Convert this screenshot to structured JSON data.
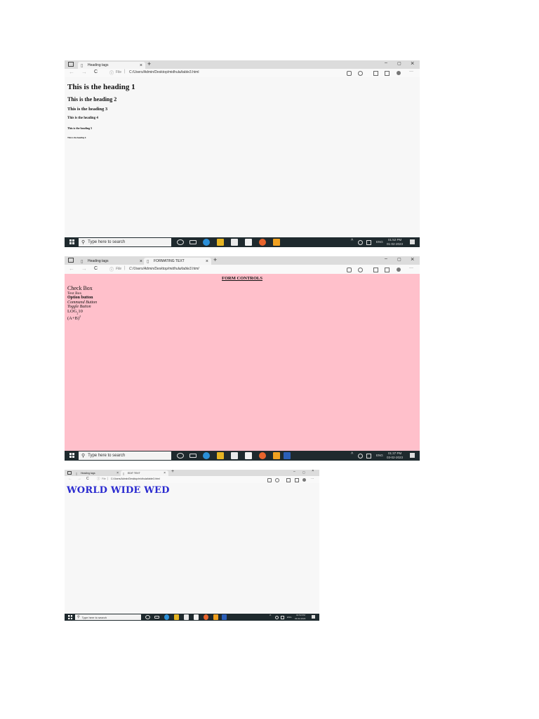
{
  "screenshot1": {
    "tab1_title": "Heading tags",
    "url": "C:/Users/Admin/Desktop/midhula/table3.html",
    "file_label": "File",
    "headings": [
      "This is the heading 1",
      "This is the heading 2",
      "This is the heading 3",
      "This is the heading 4",
      "This is the heading 5",
      "This is the heading 6"
    ],
    "taskbar": {
      "search_placeholder": "Type here to search",
      "lang": "ENG",
      "time": "01:52 PM",
      "date": "01-02-2023"
    }
  },
  "screenshot2": {
    "tab1_title": "Heading tags",
    "tab2_title": "FORMATING TEXT",
    "url": "C:/Users/Admin/Desktop/midhula/table3.html",
    "file_label": "File",
    "page_bg": "#ffc0cb",
    "title": "FORM CONTROLS",
    "items": {
      "checkbox": "Check Box",
      "textbox": "Text Box",
      "option": "Option button",
      "command": "Command Button",
      "toggle": "Toggle Button",
      "log_base": "LOG",
      "log_sub": "2",
      "log_arg": "10",
      "formula_base": "(A+B)",
      "formula_sup": "2"
    },
    "taskbar": {
      "search_placeholder": "Type here to search",
      "lang": "ENG",
      "time": "01:37 PM",
      "date": "03-02-2023"
    }
  },
  "screenshot3": {
    "tab1_title": "Heading tags",
    "tab2_title": "EDIT TEXT",
    "url": "C:/Users/Admin/Desktop/midhula/table3.html",
    "file_label": "File",
    "heading": "WORLD WIDE WED",
    "heading_color": "#2a2ad0",
    "taskbar": {
      "search_placeholder": "Type here to search",
      "lang": "ENG",
      "time": "01:53 PM",
      "date": "03-02-2023"
    }
  },
  "icons": {
    "window_menu": "tab-actions-icon",
    "page": "page-icon",
    "close": "close-icon",
    "new_tab": "plus-icon",
    "minimize": "minimize-icon",
    "maximize": "maximize-icon",
    "back": "back-arrow-icon",
    "forward": "forward-arrow-icon",
    "refresh": "refresh-icon",
    "info": "info-icon",
    "windows": "windows-start-icon",
    "search": "search-icon"
  },
  "glyphs": {
    "close": "×",
    "plus": "+",
    "minimize": "–",
    "maximize": "▢",
    "back": "←",
    "forward": "→",
    "refresh": "C",
    "info": "ⓘ",
    "divider": "|",
    "more": "···",
    "search": "⚲",
    "chevron_up": "^"
  }
}
